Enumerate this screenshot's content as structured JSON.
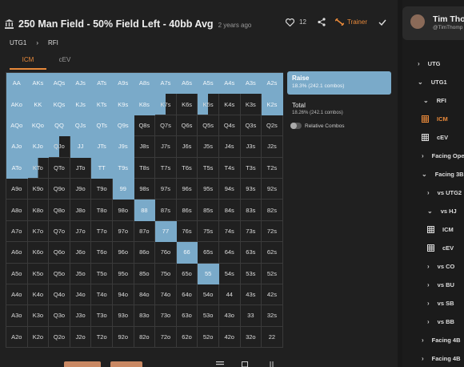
{
  "header": {
    "title": "250 Man Field - 50% Field Left - 40bb Avg",
    "ago": "2 years ago",
    "likes": "12",
    "trainer_label": "Trainer"
  },
  "breadcrumbs": [
    "UTG1",
    "RFI"
  ],
  "tabs": [
    "ICM",
    "cEV"
  ],
  "active_tab": "ICM",
  "actions": {
    "raise_label": "Raise",
    "raise_value": "18.3% (242.1 combos)",
    "total_label": "Total",
    "total_value": "18.26% (242.1 combos)",
    "relative_label": "Relative Combos"
  },
  "colors": {
    "raise": "#7aaac9",
    "accent": "#e8893a"
  },
  "grid": {
    "rows": [
      [
        "AA",
        "AKs",
        "AQs",
        "AJs",
        "ATs",
        "A9s",
        "A8s",
        "A7s",
        "A6s",
        "A5s",
        "A4s",
        "A3s",
        "A2s"
      ],
      [
        "AKo",
        "KK",
        "KQs",
        "KJs",
        "KTs",
        "K9s",
        "K8s",
        "K7s",
        "K6s",
        "K5s",
        "K4s",
        "K3s",
        "K2s"
      ],
      [
        "AQo",
        "KQo",
        "QQ",
        "QJs",
        "QTs",
        "Q9s",
        "Q8s",
        "Q7s",
        "Q6s",
        "Q5s",
        "Q4s",
        "Q3s",
        "Q2s"
      ],
      [
        "AJo",
        "KJo",
        "QJo",
        "JJ",
        "JTs",
        "J9s",
        "J8s",
        "J7s",
        "J6s",
        "J5s",
        "J4s",
        "J3s",
        "J2s"
      ],
      [
        "ATo",
        "KTo",
        "QTo",
        "JTo",
        "TT",
        "T9s",
        "T8s",
        "T7s",
        "T6s",
        "T5s",
        "T4s",
        "T3s",
        "T2s"
      ],
      [
        "A9o",
        "K9o",
        "Q9o",
        "J9o",
        "T9o",
        "99",
        "98s",
        "97s",
        "96s",
        "95s",
        "94s",
        "93s",
        "92s"
      ],
      [
        "A8o",
        "K8o",
        "Q8o",
        "J8o",
        "T8o",
        "98o",
        "88",
        "87s",
        "86s",
        "85s",
        "84s",
        "83s",
        "82s"
      ],
      [
        "A7o",
        "K7o",
        "Q7o",
        "J7o",
        "T7o",
        "97o",
        "87o",
        "77",
        "76s",
        "75s",
        "74s",
        "73s",
        "72s"
      ],
      [
        "A6o",
        "K6o",
        "Q6o",
        "J6o",
        "T6o",
        "96o",
        "86o",
        "76o",
        "66",
        "65s",
        "64s",
        "63s",
        "62s"
      ],
      [
        "A5o",
        "K5o",
        "Q5o",
        "J5o",
        "T5o",
        "95o",
        "85o",
        "75o",
        "65o",
        "55",
        "54s",
        "53s",
        "52s"
      ],
      [
        "A4o",
        "K4o",
        "Q4o",
        "J4o",
        "T4o",
        "94o",
        "84o",
        "74o",
        "64o",
        "54o",
        "44",
        "43s",
        "42s"
      ],
      [
        "A3o",
        "K3o",
        "Q3o",
        "J3o",
        "T3o",
        "93o",
        "83o",
        "73o",
        "63o",
        "53o",
        "43o",
        "33",
        "32s"
      ],
      [
        "A2o",
        "K2o",
        "Q2o",
        "J2o",
        "T2o",
        "92o",
        "82o",
        "72o",
        "62o",
        "52o",
        "42o",
        "32o",
        "22"
      ]
    ],
    "raise_freq": [
      [
        1,
        1,
        1,
        1,
        1,
        1,
        1,
        1,
        1,
        1,
        1,
        1,
        1
      ],
      [
        1,
        1,
        1,
        1,
        1,
        1,
        1,
        0.5,
        0,
        0.5,
        0,
        0,
        1
      ],
      [
        1,
        1,
        1,
        1,
        1,
        1,
        0,
        0,
        0,
        0,
        0,
        0,
        0
      ],
      [
        1,
        1,
        0.5,
        1,
        1,
        1,
        0,
        0,
        0,
        0,
        0,
        0,
        0
      ],
      [
        1,
        0.5,
        0,
        0,
        1,
        1,
        0,
        0,
        0,
        0,
        0,
        0,
        0
      ],
      [
        0,
        0,
        0,
        0,
        0,
        1,
        0,
        0,
        0,
        0,
        0,
        0,
        0
      ],
      [
        0,
        0,
        0,
        0,
        0,
        0,
        1,
        0,
        0,
        0,
        0,
        0,
        0
      ],
      [
        0,
        0,
        0,
        0,
        0,
        0,
        0,
        1,
        0,
        0,
        0,
        0,
        0
      ],
      [
        0,
        0,
        0,
        0,
        0,
        0,
        0,
        0,
        1,
        0,
        0,
        0,
        0
      ],
      [
        0,
        0,
        0,
        0,
        0,
        0,
        0,
        0,
        0,
        1,
        0,
        0,
        0
      ],
      [
        0,
        0,
        0,
        0,
        0,
        0,
        0,
        0,
        0,
        0,
        0,
        0,
        0
      ],
      [
        0,
        0,
        0,
        0,
        0,
        0,
        0,
        0,
        0,
        0,
        0,
        0,
        0
      ],
      [
        0,
        0,
        0,
        0,
        0,
        0,
        0,
        0,
        0,
        0,
        0,
        0,
        0
      ]
    ]
  },
  "sidebar": {
    "name": "Tim Thor",
    "handle": "@TimThomp",
    "items": [
      {
        "label": "UTG",
        "type": "chevron-right"
      },
      {
        "label": "UTG1",
        "type": "chevron-down"
      },
      {
        "label": "RFI",
        "type": "chevron-down"
      },
      {
        "label": "ICM",
        "type": "grid",
        "selected": true
      },
      {
        "label": "cEV",
        "type": "grid"
      },
      {
        "label": "Facing Ope",
        "type": "chevron-right"
      },
      {
        "label": "Facing 3B",
        "type": "chevron-down"
      },
      {
        "label": "vs UTG2",
        "type": "chevron-right"
      },
      {
        "label": "vs HJ",
        "type": "chevron-down"
      },
      {
        "label": "ICM",
        "type": "grid"
      },
      {
        "label": "cEV",
        "type": "grid"
      },
      {
        "label": "vs CO",
        "type": "chevron-right"
      },
      {
        "label": "vs BU",
        "type": "chevron-right"
      },
      {
        "label": "vs SB",
        "type": "chevron-right"
      },
      {
        "label": "vs BB",
        "type": "chevron-right"
      },
      {
        "label": "Facing 4B",
        "type": "chevron-right"
      },
      {
        "label": "Facing 4B",
        "type": "chevron-right"
      }
    ]
  }
}
